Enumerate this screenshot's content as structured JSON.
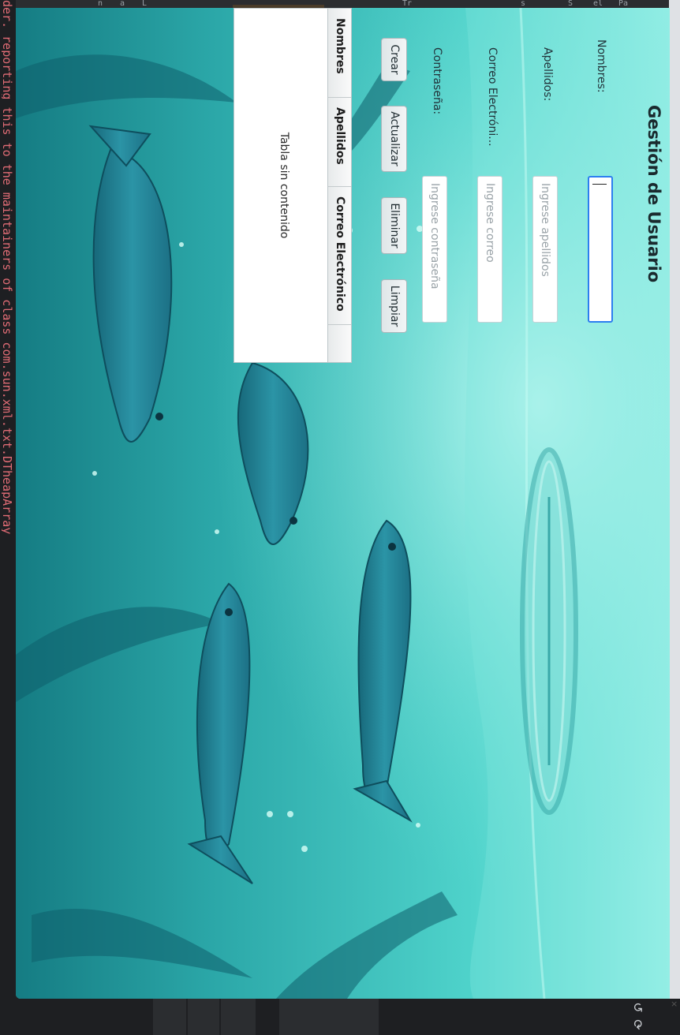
{
  "ide": {
    "side_log_text": "der. reporting this to the maintainers of class com.sun.xml.txt.DTheapArray",
    "top_fragments": [
      "L",
      "a",
      "n",
      "S",
      "s",
      "Pa",
      "el",
      "Tr"
    ]
  },
  "app": {
    "title": "Gestión de Usuario",
    "form": {
      "nombres_label": "Nombres:",
      "nombres_value": "",
      "apellidos_label": "Apellidos:",
      "apellidos_placeholder": "Ingrese apellidos",
      "correo_label": "Correo Electróni...",
      "correo_placeholder": "Ingrese correo",
      "contrasena_label": "Contraseña:",
      "contrasena_placeholder": "Ingrese contraseña"
    },
    "buttons": {
      "crear": "Crear",
      "actualizar": "Actualizar",
      "eliminar": "Eliminar",
      "limpiar": "Limpiar"
    },
    "table": {
      "columns": [
        "Nombres",
        "Apellidos",
        "Correo Electrónico"
      ],
      "empty_message": "Tabla sin contenido"
    }
  },
  "colors": {
    "water": "#46c0bd",
    "focus_accent": "#2c7ef0",
    "ide_background": "#1e1f22",
    "log_text": "#e06c75"
  },
  "icons": [
    "undo-icon",
    "refresh-icon"
  ]
}
